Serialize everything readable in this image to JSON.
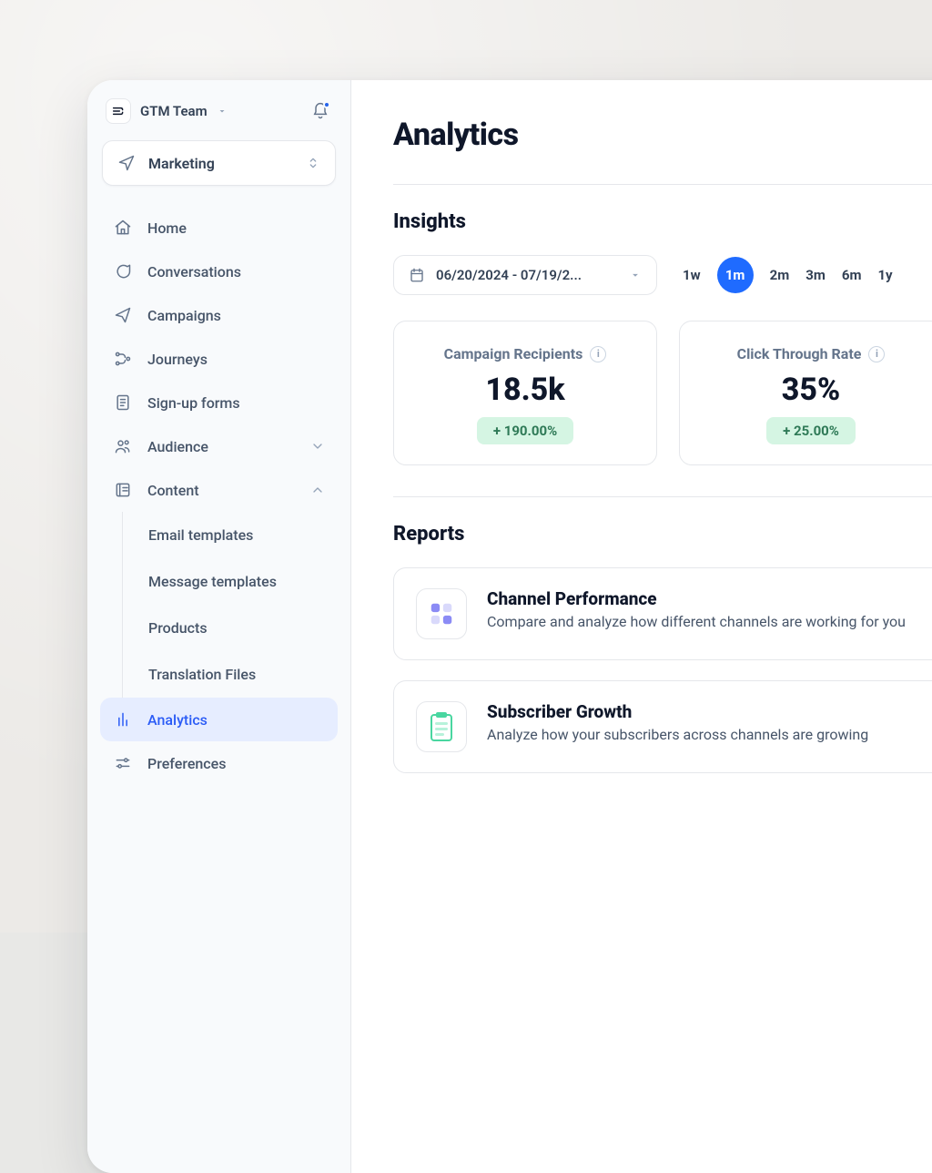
{
  "team": {
    "name": "GTM Team"
  },
  "workspace": {
    "name": "Marketing"
  },
  "nav": {
    "home": "Home",
    "conversations": "Conversations",
    "campaigns": "Campaigns",
    "journeys": "Journeys",
    "signup_forms": "Sign-up forms",
    "audience": "Audience",
    "content": "Content",
    "analytics": "Analytics",
    "preferences": "Preferences"
  },
  "content_sub": {
    "email_templates": "Email templates",
    "message_templates": "Message templates",
    "products": "Products",
    "translation_files": "Translation Files"
  },
  "page": {
    "title": "Analytics"
  },
  "insights": {
    "heading": "Insights",
    "date_range": "06/20/2024 - 07/19/2...",
    "ranges": {
      "w1": "1w",
      "m1": "1m",
      "m2": "2m",
      "m3": "3m",
      "m6": "6m",
      "y1": "1y"
    },
    "cards": {
      "recipients": {
        "label": "Campaign Recipients",
        "value": "18.5k",
        "delta": "+ 190.00%"
      },
      "ctr": {
        "label": "Click Through Rate",
        "value": "35%",
        "delta": "+ 25.00%"
      }
    }
  },
  "reports": {
    "heading": "Reports",
    "channel": {
      "title": "Channel Performance",
      "desc": "Compare and analyze how different channels are working for you"
    },
    "subscriber": {
      "title": "Subscriber Growth",
      "desc": "Analyze how your subscribers across channels are growing"
    }
  }
}
